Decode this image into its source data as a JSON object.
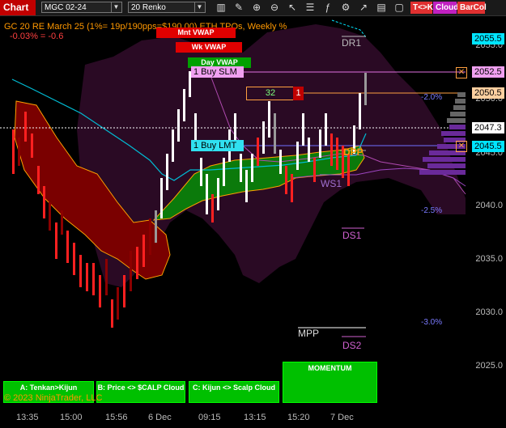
{
  "toolbar": {
    "chart_label": "Chart",
    "instrument": "MGC 02-24",
    "bar_type": "20 Renko",
    "tags": {
      "tk": "T<>K",
      "cloud": "Cloud",
      "barcol": "BarCol"
    },
    "tag_colors": {
      "tk": "#e03030",
      "cloud": "#c020c0",
      "barcol": "#e03030"
    }
  },
  "header": {
    "title": "GC 20 RE March 25 (1%= 19p/190pps=$190.00)  ETH TPOs, Weekly %",
    "pct_line": "-0.03% = -0.6"
  },
  "vwap_labels": {
    "month": "Mnt VWAP",
    "week": "Wk VWAP",
    "day": "Day VWAP"
  },
  "orders": {
    "buy_slm": "1 Buy SLM",
    "buy_lmt": "1 Buy LMT",
    "qty_box": "32",
    "qty_close": "1"
  },
  "levels": {
    "dr1": "DR1",
    "dpp": "DPP",
    "ws1": "WS1",
    "ds1": "DS1",
    "mpp": "MPP",
    "ds2": "DS2"
  },
  "pct_marks": {
    "p1": "-2.0%",
    "p2": "-2.5%",
    "p3": "-3.0%"
  },
  "price_labels": {
    "a": "2055.5",
    "b": "2052.5",
    "c": "2050.5",
    "d": "2047.3",
    "e": "2045.5"
  },
  "y_ticks": [
    "2055.0",
    "2050.0",
    "2045.0",
    "2040.0",
    "2035.0",
    "2030.0",
    "2025.0"
  ],
  "x_ticks": [
    "13:35",
    "15:00",
    "15:56",
    "6 Dec",
    "09:15",
    "13:15",
    "15:20",
    "7 Dec"
  ],
  "buttons": {
    "tenkan": "A: Tenkan>Kijun",
    "scalp": "B: Price <> $CALP Cloud",
    "kijun": "C: Kijun <> Scalp Cloud",
    "momentum": "MOMENTUM"
  },
  "copyright": "© 2023 NinjaTrader, LLC",
  "colors": {
    "bull": "#ffffff",
    "bear": "#ff2020",
    "cloud_bear": "#7a0000",
    "cloud_bull": "#0b8a0b",
    "accent": "#00e5ff"
  }
}
